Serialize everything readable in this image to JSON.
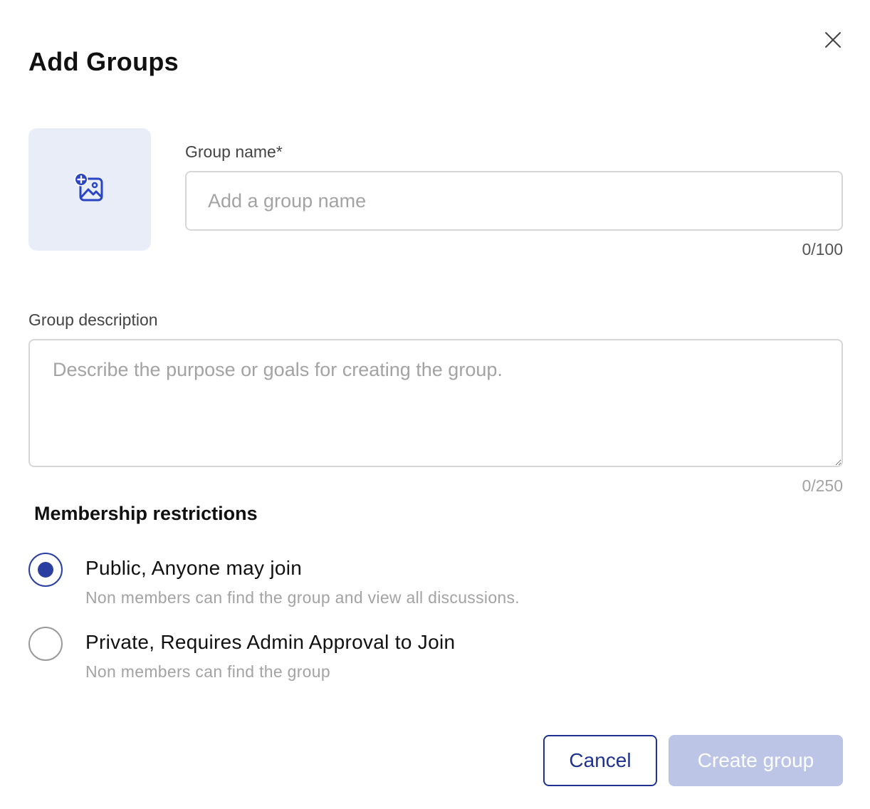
{
  "dialog": {
    "title": "Add Groups",
    "close_icon": "close-icon"
  },
  "image_upload": {
    "icon": "add-image-icon",
    "accent_color": "#2a45c4",
    "background": "#e8edf8"
  },
  "group_name": {
    "label": "Group name*",
    "placeholder": "Add a group name",
    "value": "",
    "counter": "0/100"
  },
  "group_description": {
    "label": "Group description",
    "placeholder": "Describe the purpose or goals for creating the group.",
    "value": "",
    "counter": "0/250"
  },
  "membership": {
    "title": "Membership restrictions",
    "options": [
      {
        "label": "Public, Anyone may join",
        "description": "Non members can find the group and view all discussions.",
        "selected": true
      },
      {
        "label": "Private, Requires Admin Approval to Join",
        "description": "Non members can find the group",
        "selected": false
      }
    ]
  },
  "buttons": {
    "cancel_label": "Cancel",
    "create_label": "Create group",
    "create_disabled": true
  },
  "colors": {
    "primary": "#1f3290",
    "primary_disabled": "#bcc5e6",
    "radio_selected": "#2a3fa0",
    "placeholder": "#a3a3a3"
  }
}
